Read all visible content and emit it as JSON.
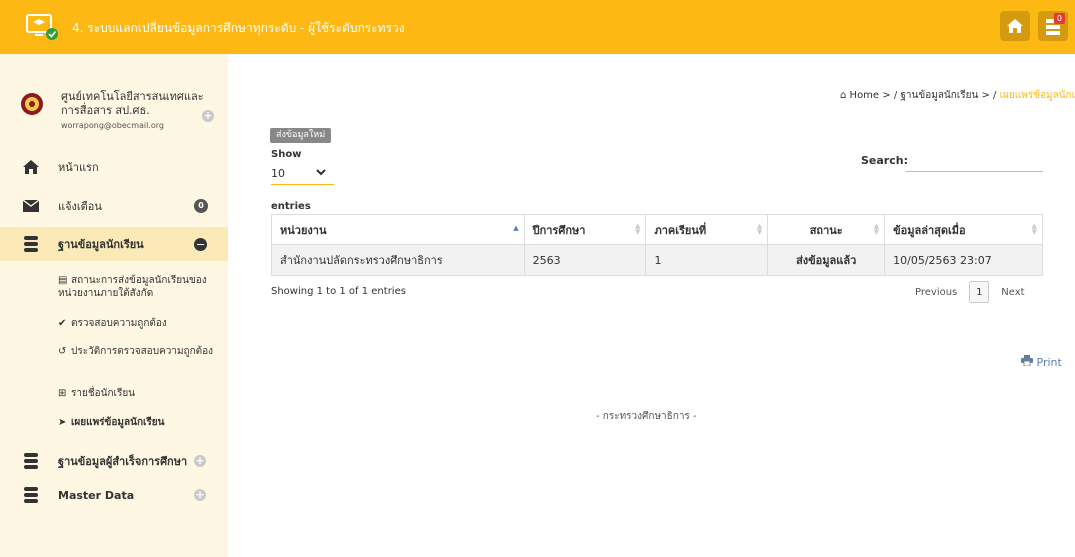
{
  "header": {
    "title": "4. ระบบแลกเปลี่ยนข้อมูลการศึกษาทุกระดับ - ผู้ใช้ระดับกระทรวง",
    "notification_count": "0",
    "colors": {
      "bar": "#fdb813",
      "button": "#d49a10",
      "badge": "#e53935"
    }
  },
  "profile": {
    "name": "ศูนย์เทคโนโลยีสารสนเทศและการสื่อสาร สป.ศธ.",
    "email": "worrapong@obecmail.org"
  },
  "sidebar": {
    "items": [
      {
        "label": "หน้าแรก",
        "icon": "home-icon"
      },
      {
        "label": "แจ้งเตือน",
        "icon": "envelope-icon",
        "badge": "0"
      },
      {
        "label": "ฐานข้อมูลนักเรียน",
        "icon": "database-icon"
      },
      {
        "label": "ฐานข้อมูลผู้สำเร็จการศึกษา",
        "icon": "database-icon"
      },
      {
        "label": "Master Data",
        "icon": "database-icon"
      }
    ],
    "subitems": [
      {
        "label": "สถานะการส่งข้อมูลนักเรียนของหน่วยงานภายใต้สังกัด",
        "icon": "list-icon"
      },
      {
        "label": "ตรวจสอบความถูกต้อง",
        "icon": "check-icon"
      },
      {
        "label": "ประวัติการตรวจสอบความถูกต้อง",
        "icon": "history-icon"
      },
      {
        "label": "รายชื่อนักเรียน",
        "icon": "table-icon"
      },
      {
        "label": "เผยแพร่ข้อมูลนักเรียน",
        "icon": "send-icon"
      }
    ]
  },
  "breadcrumb": {
    "home": "Home",
    "sep": ">",
    "level1": "ฐานข้อมูลนักเรียน",
    "current": "เผยแพร่ข้อมูลนักเรียน"
  },
  "toolbar": {
    "send_label": "ส่งข้อมูลใหม่",
    "show_label": "Show",
    "page_size": "10",
    "entries_label": "entries",
    "search_label": "Search:",
    "search_value": ""
  },
  "table": {
    "headers": [
      "หน่วยงาน",
      "ปีการศึกษา",
      "ภาคเรียนที่",
      "สถานะ",
      "ข้อมูลล่าสุดเมื่อ"
    ],
    "rows": [
      [
        "สำนักงานปลัดกระทรวงศึกษาธิการ",
        "2563",
        "1",
        "ส่งข้อมูลแล้ว",
        "10/05/2563 23:07"
      ]
    ]
  },
  "pagination": {
    "info": "Showing 1 to 1 of 1 entries",
    "previous": "Previous",
    "page": "1",
    "next": "Next"
  },
  "print_label": "Print",
  "footer": "- กระทรวงศึกษาธิการ -"
}
